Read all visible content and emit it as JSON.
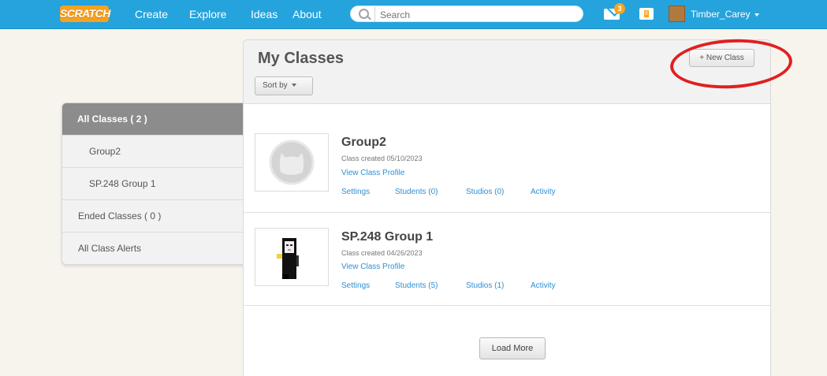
{
  "nav": {
    "logo": "SCRATCH",
    "links": [
      "Create",
      "Explore",
      "Ideas",
      "About"
    ],
    "search_placeholder": "Search",
    "messages_count": "3",
    "folder_badge": "8",
    "username": "Timber_Carey"
  },
  "sidebar": {
    "items": [
      {
        "label": "All Classes ( 2 )"
      },
      {
        "label": "Group2"
      },
      {
        "label": "SP.248 Group 1"
      },
      {
        "label": "Ended Classes ( 0 )"
      },
      {
        "label": "All Class Alerts"
      }
    ]
  },
  "main": {
    "title": "My Classes",
    "new_class_label": "+ New Class",
    "sort_label": "Sort by",
    "classes": [
      {
        "name": "Group2",
        "created": "Class created 05/10/2023",
        "profile_link": "View Class Profile",
        "settings": "Settings",
        "students": "Students (0)",
        "studios": "Studios (0)",
        "activity": "Activity"
      },
      {
        "name": "SP.248 Group 1",
        "created": "Class created 04/26/2023",
        "profile_link": "View Class Profile",
        "settings": "Settings",
        "students": "Students (5)",
        "studios": "Studios (1)",
        "activity": "Activity"
      }
    ],
    "load_more_label": "Load More"
  },
  "colors": {
    "nav": "#25a3dc",
    "link": "#2e8fd1",
    "annotation": "#e02020",
    "badge": "#f7a51c"
  }
}
